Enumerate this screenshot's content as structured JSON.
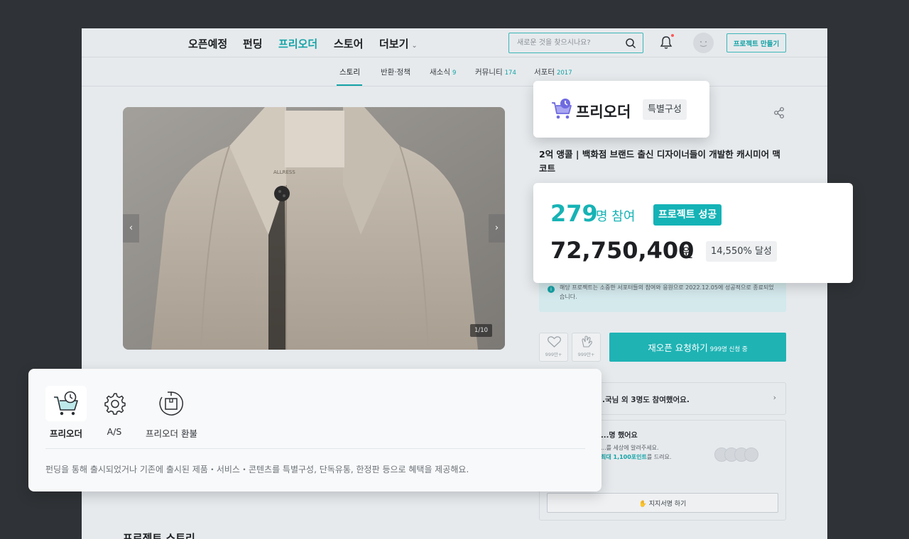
{
  "nav": {
    "items": [
      "오픈예정",
      "펀딩",
      "프리오더",
      "스토어",
      "더보기"
    ],
    "active_index": 2,
    "search_placeholder": "새로운 것을 찾으시나요?",
    "make_project_label": "프로젝트 만들기"
  },
  "subtabs": [
    {
      "label": "스토리",
      "count": ""
    },
    {
      "label": "반환·정책",
      "count": ""
    },
    {
      "label": "새소식",
      "count": "9"
    },
    {
      "label": "커뮤니티",
      "count": "174"
    },
    {
      "label": "서포터",
      "count": "2017"
    }
  ],
  "gallery": {
    "counter": "1/10",
    "tag_text": "ALLRESS"
  },
  "product": {
    "type_label": "프리오더",
    "type_badge": "특별구성",
    "title": "2억 앵콜 | 백화점 브랜드 출신 디자이너들이 개발한 캐시미어 맥코트"
  },
  "stats": {
    "participants": "279",
    "participants_unit": "명 참여",
    "status_badge": "프로젝트 성공",
    "amount": "72,750,400",
    "amount_unit": "원",
    "rate_badge": "14,550% 달성"
  },
  "notice": {
    "text": "해당 프로젝트는 소중한 서포터들의 참여와 응원으로 2022.12.05에 성공적으로 종료되었습니다."
  },
  "actions": {
    "like_count": "999만+",
    "cheer_count": "999만+",
    "reopen_label": "재오픈 요청하기",
    "reopen_sub": "999명 신청 중"
  },
  "join_card": {
    "text": "...국님 외 3명도 참여했어요."
  },
  "support_card": {
    "title": "...명 했어요",
    "line1": "...를 세상에 알려주세요.",
    "line2_bold": "최대 1,100포인트",
    "line2_rest": "를 드려요.",
    "sign_label": "지지서명 하기"
  },
  "story_heading": "프로젝트 스토리",
  "type_card": {
    "items": [
      {
        "label": "프리오더",
        "icon": "cart-clock-icon",
        "selected": true
      },
      {
        "label": "A/S",
        "icon": "gear-icon",
        "selected": false
      },
      {
        "label": "프리오더 환불",
        "icon": "refund-box-icon",
        "selected": false
      }
    ],
    "description": "펀딩을 통해 출시되었거나 기존에 출시된 제품・서비스・콘텐츠를 특별구성, 단독유통, 한정판 등으로 혜택을 제공해요."
  },
  "colors": {
    "accent": "#14a3a6",
    "accent_button": "#1fb3b4",
    "page_bg": "#e6eaed",
    "backdrop": "#2f3236"
  }
}
